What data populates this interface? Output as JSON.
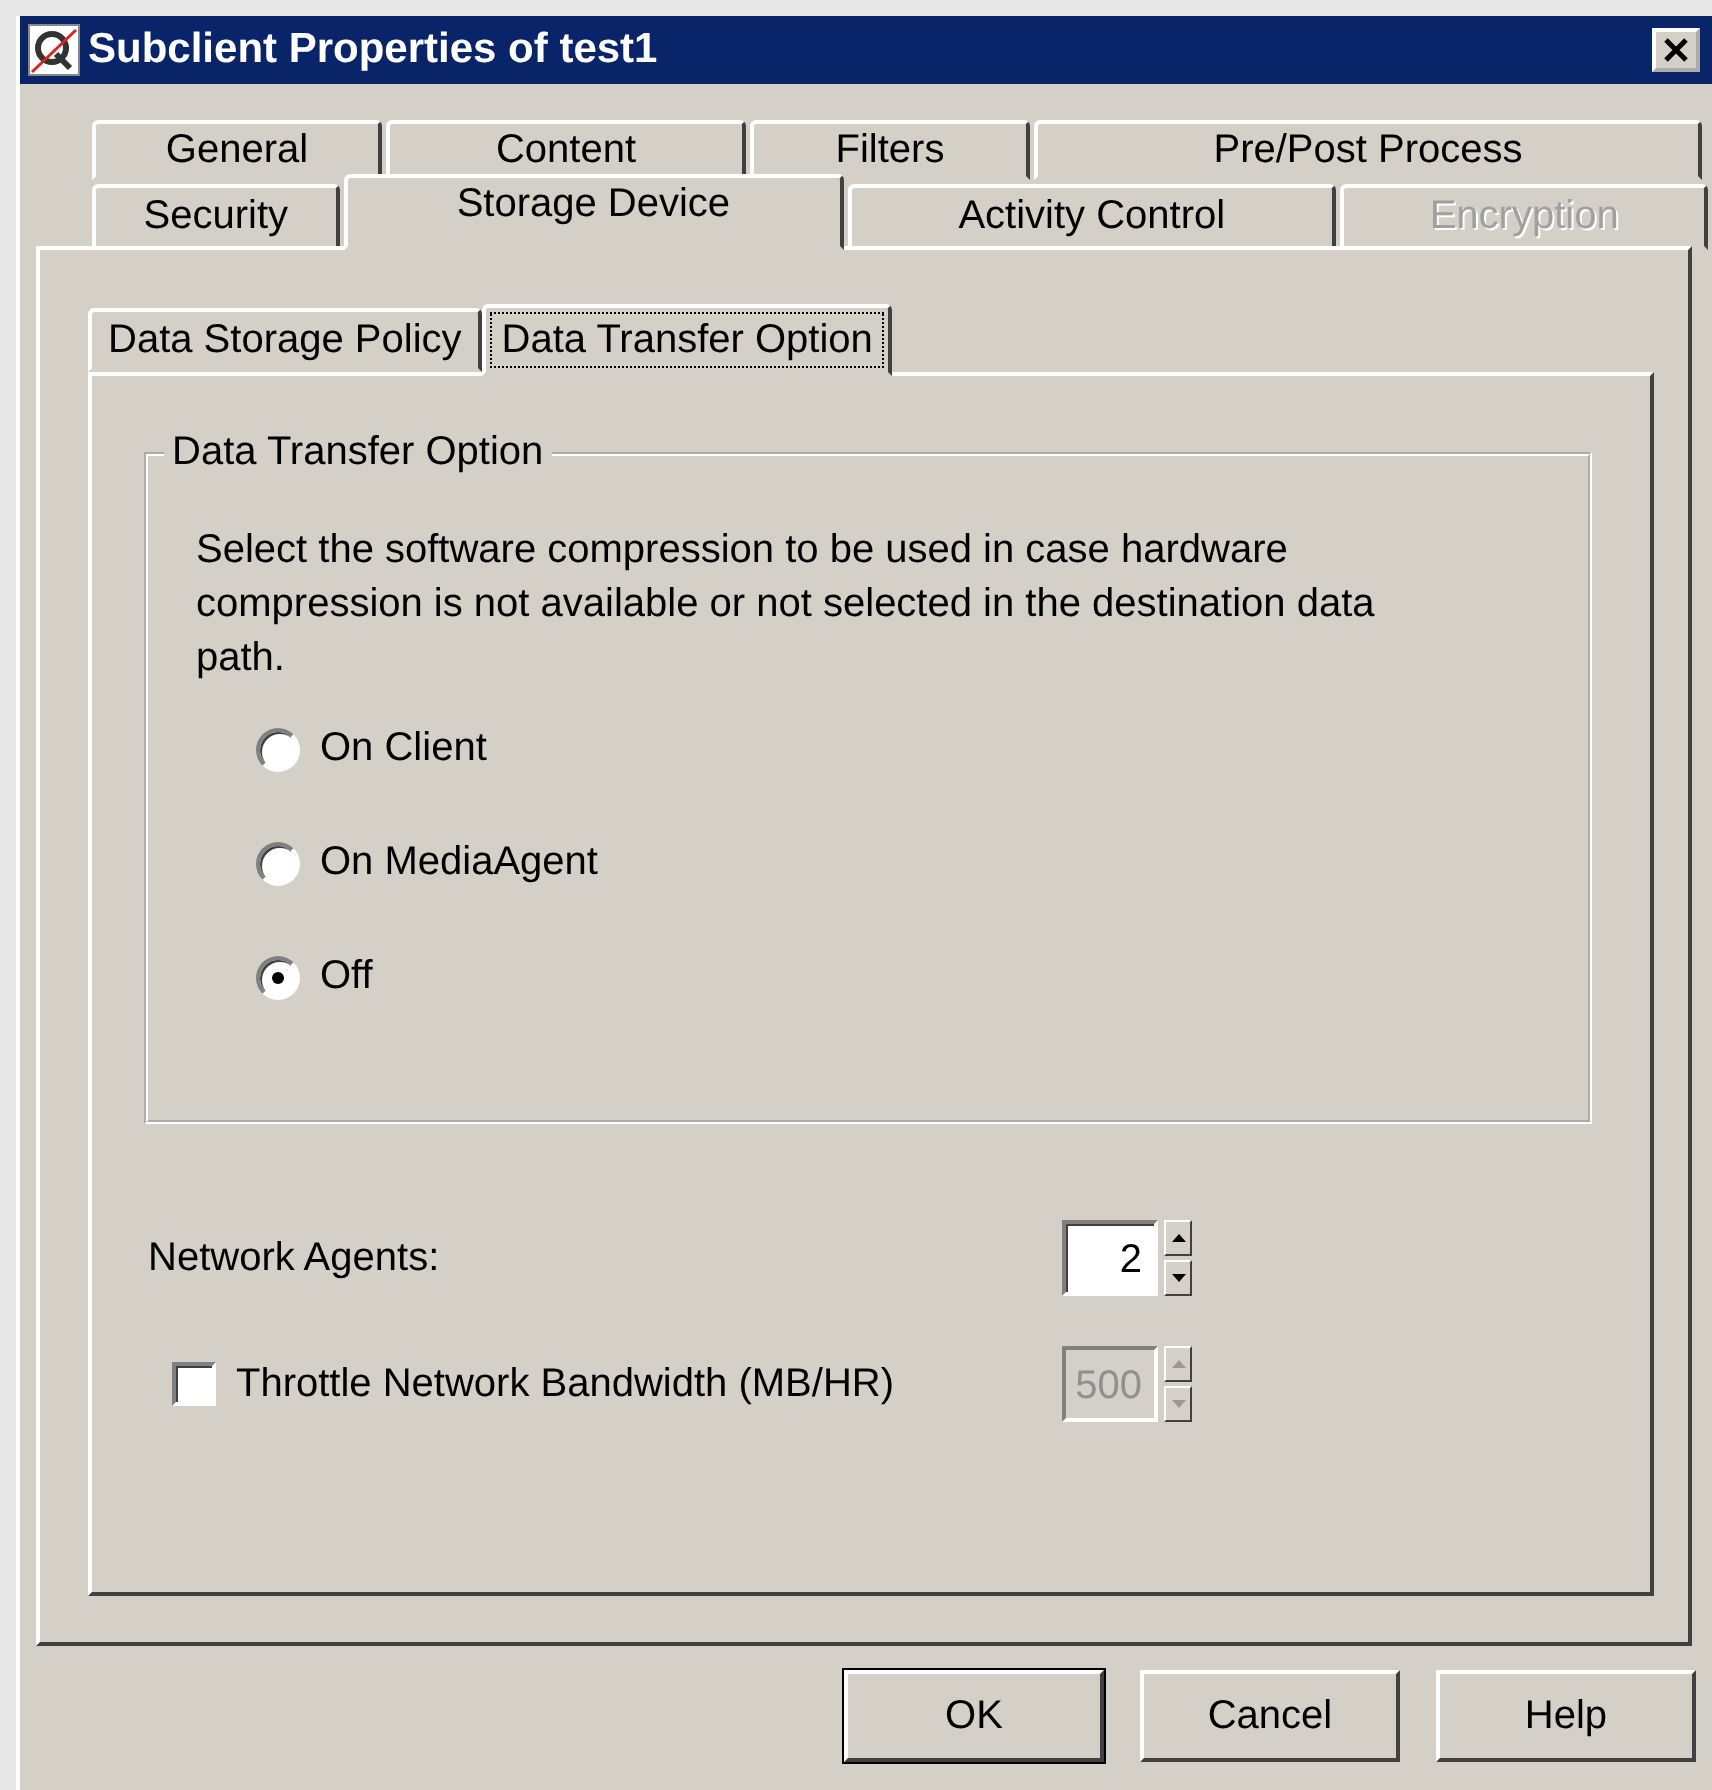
{
  "window": {
    "title": "Subclient Properties of test1"
  },
  "tab_rows": [
    {
      "tabs": [
        {
          "label": "General",
          "selected": false,
          "disabled": false
        },
        {
          "label": "Content",
          "selected": false,
          "disabled": false
        },
        {
          "label": "Filters",
          "selected": false,
          "disabled": false
        },
        {
          "label": "Pre/Post Process",
          "selected": false,
          "disabled": false
        }
      ]
    },
    {
      "tabs": [
        {
          "label": "Security",
          "selected": false,
          "disabled": false
        },
        {
          "label": "Storage Device",
          "selected": true,
          "disabled": false
        },
        {
          "label": "Activity Control",
          "selected": false,
          "disabled": false
        },
        {
          "label": "Encryption",
          "selected": false,
          "disabled": true
        }
      ]
    }
  ],
  "subtabs": [
    {
      "label": "Data Storage Policy",
      "selected": false
    },
    {
      "label": "Data Transfer Option",
      "selected": true
    }
  ],
  "group": {
    "title": "Data Transfer Option",
    "description": "Select the software compression to be used in case hardware compression is not available or not selected in the destination data path.",
    "options": [
      {
        "label": "On Client",
        "selected": false
      },
      {
        "label": "On MediaAgent",
        "selected": false
      },
      {
        "label": "Off",
        "selected": true
      }
    ]
  },
  "network_agents": {
    "label": "Network Agents:",
    "value": "2"
  },
  "throttle": {
    "label": "Throttle Network Bandwidth (MB/HR)",
    "checked": false,
    "value": "500",
    "disabled": true
  },
  "buttons": [
    {
      "label": "OK",
      "default": true
    },
    {
      "label": "Cancel",
      "default": false
    },
    {
      "label": "Help",
      "default": false
    }
  ]
}
